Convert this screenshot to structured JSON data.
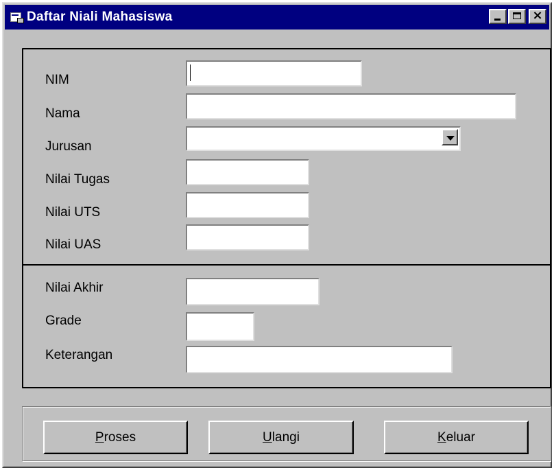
{
  "window": {
    "title": "Daftar Niali Mahasiswa",
    "controls": {
      "minimize": "minimize",
      "maximize": "maximize",
      "close": "×"
    }
  },
  "form": {
    "nim": {
      "label": "NIM",
      "value": ""
    },
    "nama": {
      "label": "Nama",
      "value": ""
    },
    "jurusan": {
      "label": "Jurusan",
      "value": ""
    },
    "nilai_tugas": {
      "label": "Nilai Tugas",
      "value": ""
    },
    "nilai_uts": {
      "label": "Nilai UTS",
      "value": ""
    },
    "nilai_uas": {
      "label": "Nilai UAS",
      "value": ""
    }
  },
  "result": {
    "nilai_akhir": {
      "label": "Nilai Akhir",
      "value": ""
    },
    "grade": {
      "label": "Grade",
      "value": ""
    },
    "keterangan": {
      "label": "Keterangan",
      "value": ""
    }
  },
  "buttons": {
    "proses": {
      "accel": "P",
      "rest": "roses"
    },
    "ulangi": {
      "accel": "U",
      "rest": "langi"
    },
    "keluar": {
      "accel": "K",
      "rest": "eluar"
    }
  },
  "colors": {
    "titlebar": "#000080",
    "face": "#c0c0c0"
  },
  "icons": [
    "app-window-icon",
    "minimize-icon",
    "maximize-icon",
    "close-icon",
    "dropdown-arrow-icon"
  ]
}
